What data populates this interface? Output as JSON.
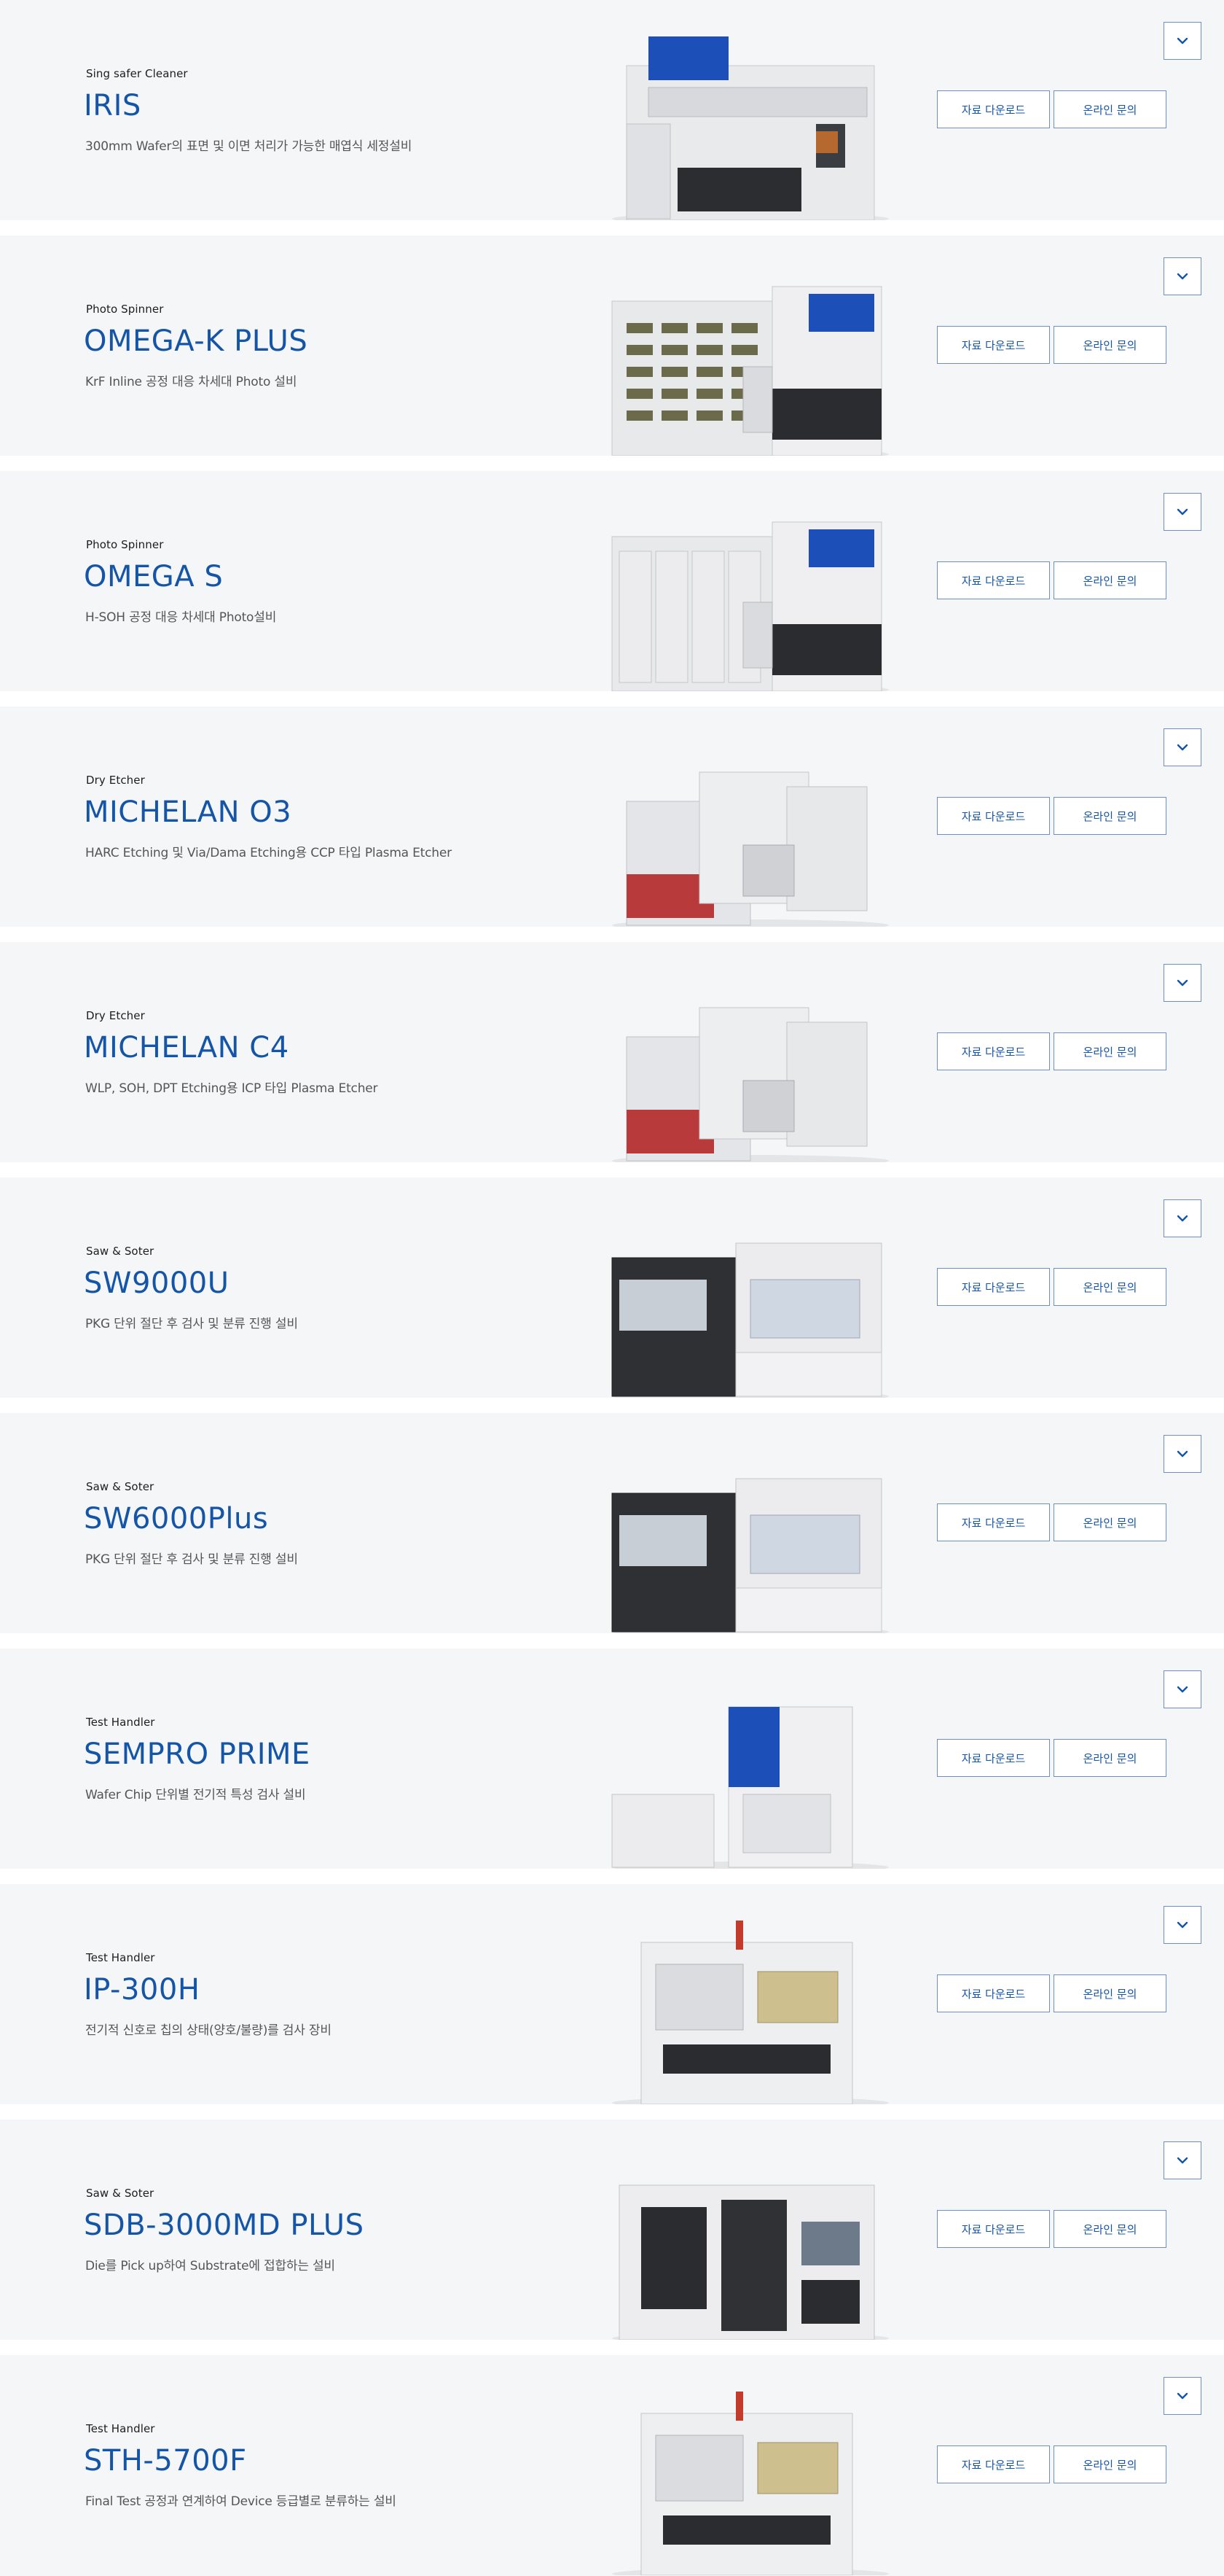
{
  "products": [
    {
      "category": "Sing safer Cleaner",
      "name": "IRIS",
      "desc": "300mm Wafer의 표면 및 이면 처리가 가능한 매엽식 세정설비",
      "download_label": "자료 다운로드",
      "inquiry_label": "온라인 문의",
      "style": "cleaner"
    },
    {
      "category": "Photo Spinner",
      "name": "OMEGA-K PLUS",
      "desc": "KrF Inline 공정 대응 차세대 Photo 설비",
      "download_label": "자료 다운로드",
      "inquiry_label": "온라인 문의",
      "style": "spinner-k"
    },
    {
      "category": "Photo Spinner",
      "name": "OMEGA S",
      "desc": "H-SOH 공정 대응 차세대 Photo설비",
      "download_label": "자료 다운로드",
      "inquiry_label": "온라인 문의",
      "style": "spinner-s"
    },
    {
      "category": "Dry Etcher",
      "name": "MICHELAN O3",
      "desc": "HARC Etching 및 Via/Dama Etching용 CCP 타입 Plasma Etcher",
      "download_label": "자료 다운로드",
      "inquiry_label": "온라인 문의",
      "style": "etcher"
    },
    {
      "category": "Dry Etcher",
      "name": "MICHELAN C4",
      "desc": "WLP, SOH, DPT Etching용 ICP 타입 Plasma Etcher",
      "download_label": "자료 다운로드",
      "inquiry_label": "온라인 문의",
      "style": "etcher"
    },
    {
      "category": "Saw & Soter",
      "name": "SW9000U",
      "desc": "PKG 단위 절단 후 검사 및 분류 진행 설비",
      "download_label": "자료 다운로드",
      "inquiry_label": "온라인 문의",
      "style": "saw"
    },
    {
      "category": "Saw & Soter",
      "name": "SW6000Plus",
      "desc": "PKG 단위 절단 후 검사 및 분류 진행 설비",
      "download_label": "자료 다운로드",
      "inquiry_label": "온라인 문의",
      "style": "saw"
    },
    {
      "category": "Test Handler",
      "name": "SEMPRO PRIME",
      "desc": "Wafer Chip 단위별 전기적 특성 검사 설비",
      "download_label": "자료 다운로드",
      "inquiry_label": "온라인 문의",
      "style": "prober"
    },
    {
      "category": "Test Handler",
      "name": "IP-300H",
      "desc": "전기적 신호로 칩의 상태(양호/불량)를 검사 장비",
      "download_label": "자료 다운로드",
      "inquiry_label": "온라인 문의",
      "style": "handler"
    },
    {
      "category": "Saw & Soter",
      "name": "SDB-3000MD PLUS",
      "desc": "Die를 Pick up하여 Substrate에 접합하는 설비",
      "download_label": "자료 다운로드",
      "inquiry_label": "온라인 문의",
      "style": "bonder"
    },
    {
      "category": "Test Handler",
      "name": "STH-5700F",
      "desc": "Final Test 공정과 연계하여 Device 등급별로 분류하는 설비",
      "download_label": "자료 다운로드",
      "inquiry_label": "온라인 문의",
      "style": "handler"
    }
  ],
  "toggle_icon": "chevron-down-icon",
  "colors": {
    "accent": "#1555a8",
    "border": "#6d8fc6",
    "card_bg": "#f5f6f7"
  }
}
